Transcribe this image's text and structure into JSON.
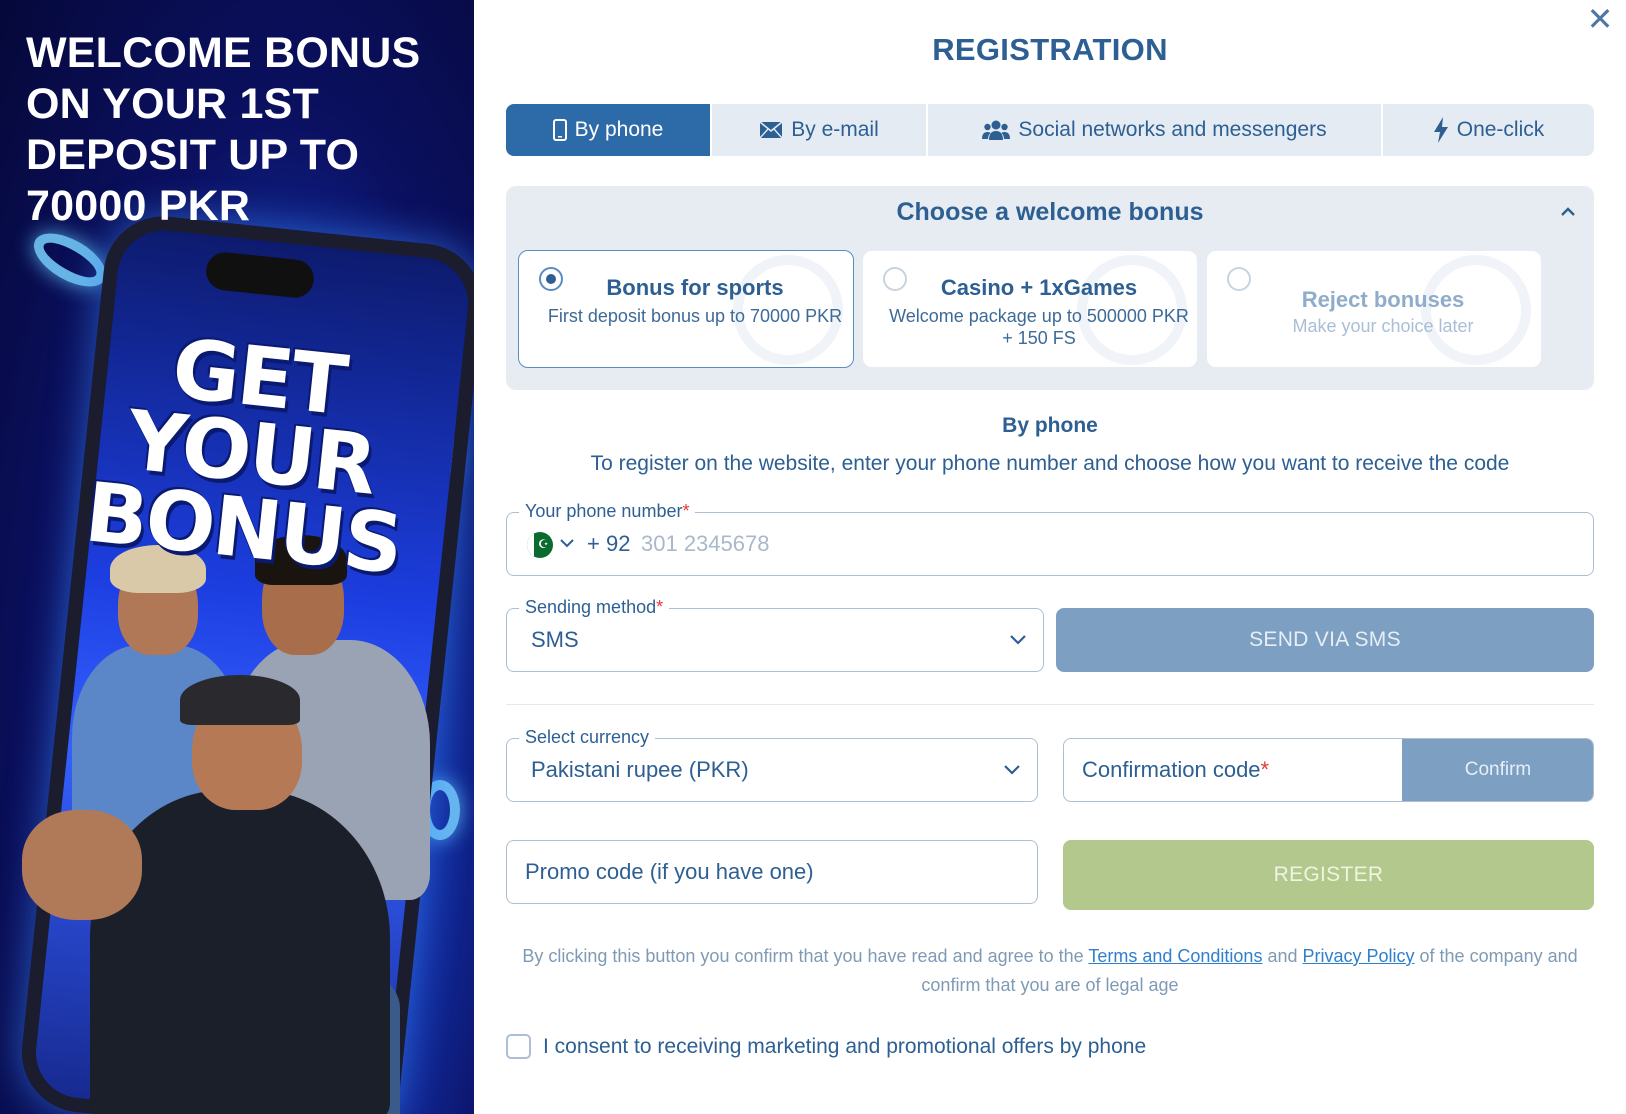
{
  "promo": {
    "headline": "WELCOME BONUS ON YOUR 1ST DEPOSIT UP TO 70000 PKR",
    "phone_text": "GET YOUR BONUS"
  },
  "modal": {
    "title": "REGISTRATION",
    "close_icon": "close-icon"
  },
  "tabs": [
    {
      "label": "By phone",
      "icon": "phone-icon",
      "active": true
    },
    {
      "label": "By e-mail",
      "icon": "mail-icon",
      "active": false
    },
    {
      "label": "Social networks and messengers",
      "icon": "people-icon",
      "active": false
    },
    {
      "label": "One-click",
      "icon": "lightning-icon",
      "active": false
    }
  ],
  "bonus": {
    "title": "Choose a welcome bonus",
    "options": [
      {
        "name": "Bonus for sports",
        "desc": "First deposit bonus up to 70000 PKR",
        "selected": true
      },
      {
        "name": "Casino + 1xGames",
        "desc": "Welcome package up to 500000 PKR + 150 FS",
        "selected": false
      },
      {
        "name": "Reject bonuses",
        "desc": "Make your choice later",
        "selected": false
      }
    ]
  },
  "method": {
    "title": "By phone",
    "description": "To register on the website, enter your phone number and choose how you want to receive the code"
  },
  "phone": {
    "label": "Your phone number",
    "required_mark": "*",
    "country_prefix": "+ 92",
    "placeholder": "301 2345678"
  },
  "sending": {
    "label": "Sending method",
    "required_mark": "*",
    "value": "SMS",
    "button": "SEND VIA SMS"
  },
  "currency": {
    "label": "Select currency",
    "value": "Pakistani rupee (PKR)"
  },
  "confirmation": {
    "label": "Confirmation code",
    "required_mark": "*",
    "button": "Confirm"
  },
  "promo_code": {
    "placeholder": "Promo code (if you have one)"
  },
  "register": {
    "button": "REGISTER"
  },
  "terms": {
    "before": "By clicking this button you confirm that you have read and agree to the ",
    "terms_link": "Terms and Conditions",
    "and": " and ",
    "privacy_link": "Privacy Policy",
    "after": " of the company and confirm that you are of legal age"
  },
  "consent": {
    "label": "I consent to receiving marketing and promotional offers by phone",
    "checked": false
  },
  "colors": {
    "primary": "#2d5f93",
    "tab_active": "#2d6aa8",
    "button_disabled": "#7c9fc2",
    "register": "#b3c88c",
    "link": "#2f7fcf",
    "required": "#e53935"
  }
}
